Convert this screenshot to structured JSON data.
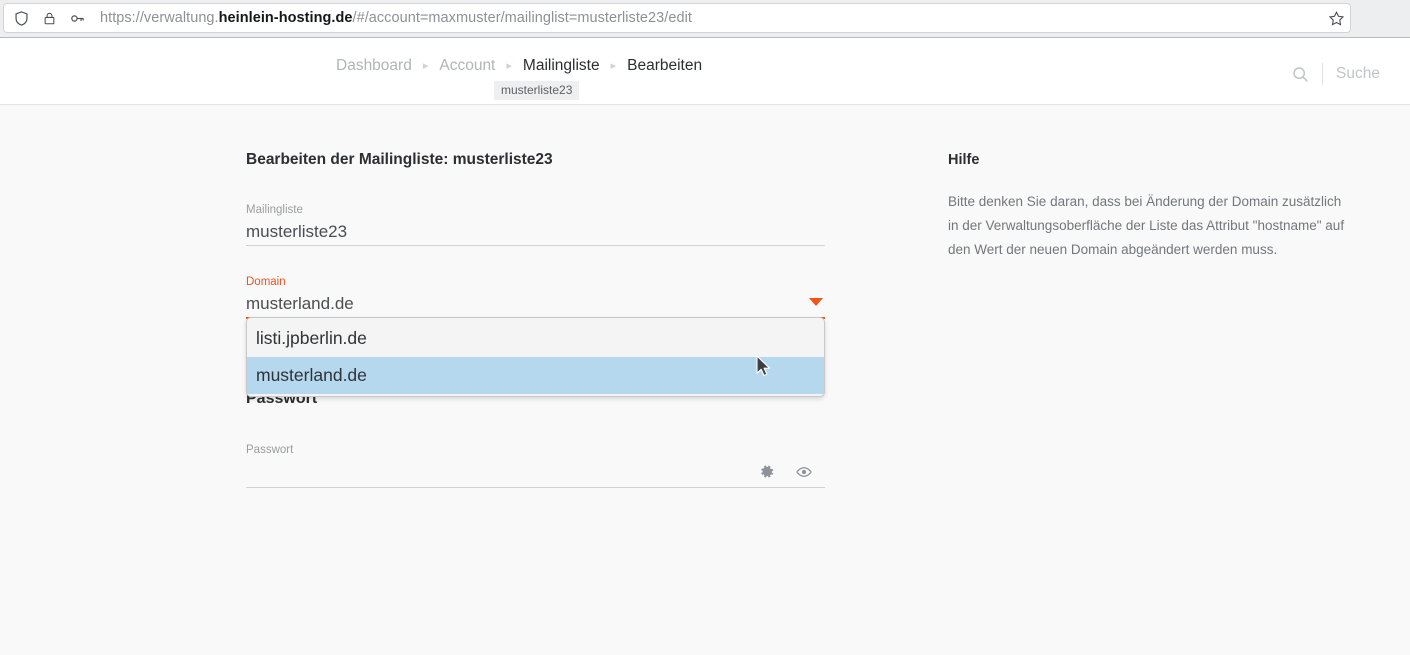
{
  "browser": {
    "url_prefix": "https://verwaltung.",
    "url_host": "heinlein-hosting.de",
    "url_suffix": "/#/account=maxmuster/mailinglist=musterliste23/edit",
    "shield_icon": "shield-icon",
    "lock_icon": "lock-icon",
    "key_icon": "key-icon",
    "star_icon": "star-icon"
  },
  "header": {
    "breadcrumb": [
      {
        "label": "Dashboard",
        "active": false
      },
      {
        "label": "Account",
        "active": false
      },
      {
        "label": "Mailingliste",
        "active": true
      },
      {
        "label": "Bearbeiten",
        "active": true
      }
    ],
    "breadcrumb_separator": "▸",
    "breadcrumb_sublabel": "musterliste23",
    "search": {
      "icon": "search-icon",
      "placeholder": "Suche",
      "value": ""
    }
  },
  "main": {
    "page_title": "Bearbeiten der Mailingliste: musterliste23",
    "fields": {
      "mailingliste": {
        "label": "Mailingliste",
        "value": "musterliste23"
      },
      "domain": {
        "label": "Domain",
        "value": "musterland.de",
        "caret_icon": "chevron-down-icon",
        "options": [
          {
            "label": "listi.jpberlin.de",
            "selected": false
          },
          {
            "label": "musterland.de",
            "selected": true
          }
        ]
      },
      "passwort": {
        "section_title": "Passwort",
        "label": "Passwort",
        "value": "",
        "gear_icon": "gear-icon",
        "eye_icon": "eye-icon"
      }
    }
  },
  "help": {
    "title": "Hilfe",
    "text": "Bitte denken Sie daran, dass bei Änderung der Domain zusätzlich in der Verwaltungsoberfläche der Liste das Attribut \"hostname\" auf den Wert der neuen Domain abgeändert werden muss."
  },
  "colors": {
    "accent": "#f2531b",
    "highlight": "#b5d8ee",
    "body_bg": "#f9f9fa"
  }
}
